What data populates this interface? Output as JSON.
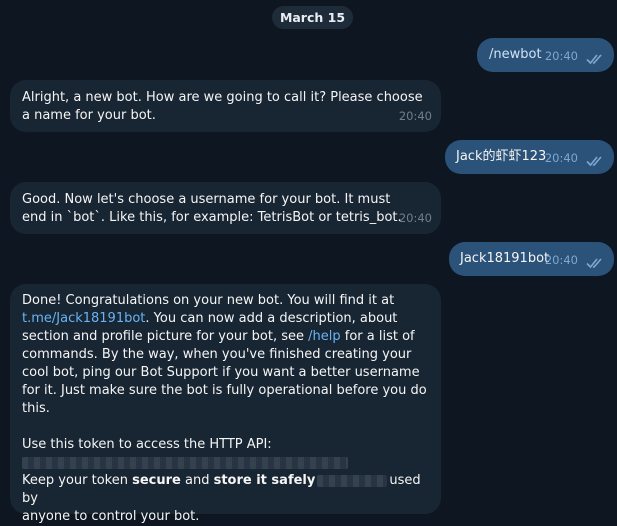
{
  "date_label": "March 15",
  "messages": {
    "m1": {
      "text": "/newbot",
      "time": "20:40"
    },
    "m2": {
      "text": "Alright, a new bot. How are we going to call it? Please choose a name for your bot.",
      "time": "20:40"
    },
    "m3": {
      "text": "Jack的虾虾123",
      "time": "20:40"
    },
    "m4": {
      "text": "Good. Now let's choose a username for your bot. It must end in `bot`. Like this, for example: TetrisBot or tetris_bot.",
      "time": "20:40"
    },
    "m5": {
      "text": "Jack18191bot",
      "time": "20:40"
    },
    "m6": {
      "p1_a": "Done! Congratulations on your new bot. You will find it at ",
      "p1_link": "t.me/Jack18191bot",
      "p1_b": ". You can now add a description, about section and profile picture for your bot, see ",
      "p1_cmd": "/help",
      "p1_c": " for a list of commands. By the way, when you've finished creating your cool bot, ping our Bot Support if you want a better username for it. Just make sure the bot is fully operational before you do this.",
      "p2": "Use this token to access the HTTP API:",
      "p3_a": "Keep your token ",
      "p3_secure": "secure",
      "p3_b": " and ",
      "p3_store": "store it safely",
      "p3_c": "used by",
      "p3_d": "anyone to control your bot."
    }
  },
  "colors": {
    "background": "#0e1621",
    "incoming_bubble": "#182533",
    "outgoing_bubble": "#2b5278",
    "link": "#6ab3f3"
  },
  "icons": {
    "read_receipt": "double-check-icon"
  }
}
